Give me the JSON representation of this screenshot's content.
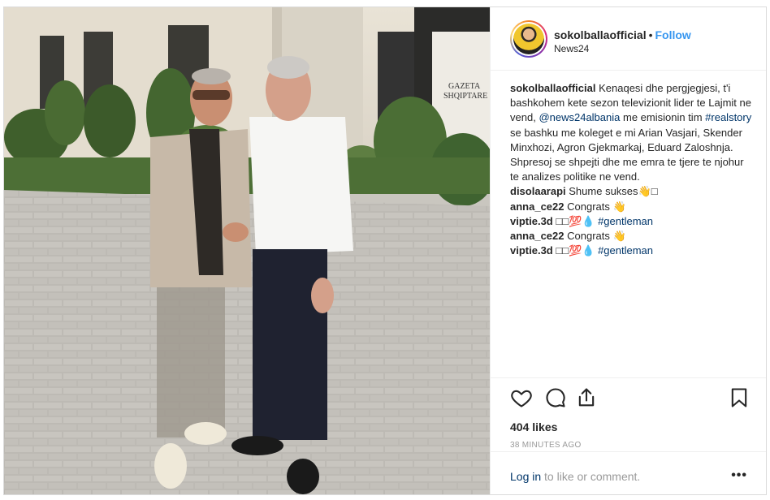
{
  "post": {
    "username": "sokolballaofficial",
    "separator": "•",
    "follow_label": "Follow",
    "location": "News24",
    "photo_sign": [
      "GAZETA",
      "SHQIPTARE"
    ]
  },
  "caption": {
    "username": "sokolballaofficial",
    "text_part1": "Kenaqesi dhe pergjegjesi, t'i bashkohem kete sezon televizionit lider te Lajmit ne vend,",
    "mention": "@news24albania",
    "text_part2": "me emisionin tim",
    "hashtag": "#realstory",
    "text_part3": "se bashku me koleget e mi Arian Vasjari, Skender Minxhozi, Agron Gjekmarkaj, Eduard Zaloshnja. Shpresoj se shpejti dhe me emra te tjere te njohur te analizes politike ne vend."
  },
  "comments": [
    {
      "user": "disolaarapi",
      "text": "Shume sukses👋□",
      "tag": ""
    },
    {
      "user": "anna_ce22",
      "text": "Congrats 👋",
      "tag": ""
    },
    {
      "user": "viptie.3d",
      "text": "□□💯💧",
      "tag": "#gentleman"
    },
    {
      "user": "anna_ce22",
      "text": "Congrats 👋",
      "tag": ""
    },
    {
      "user": "viptie.3d",
      "text": "□□💯💧",
      "tag": "#gentleman"
    }
  ],
  "actions": {
    "likes": "404 likes",
    "time": "38 MINUTES AGO",
    "login_link": "Log in",
    "login_rest": " to like or comment.",
    "more": "•••"
  },
  "icons": [
    "heart-icon",
    "comment-icon",
    "share-icon",
    "bookmark-icon"
  ],
  "colors": {
    "link": "#003569",
    "follow": "#3897f0",
    "muted": "#999999"
  }
}
